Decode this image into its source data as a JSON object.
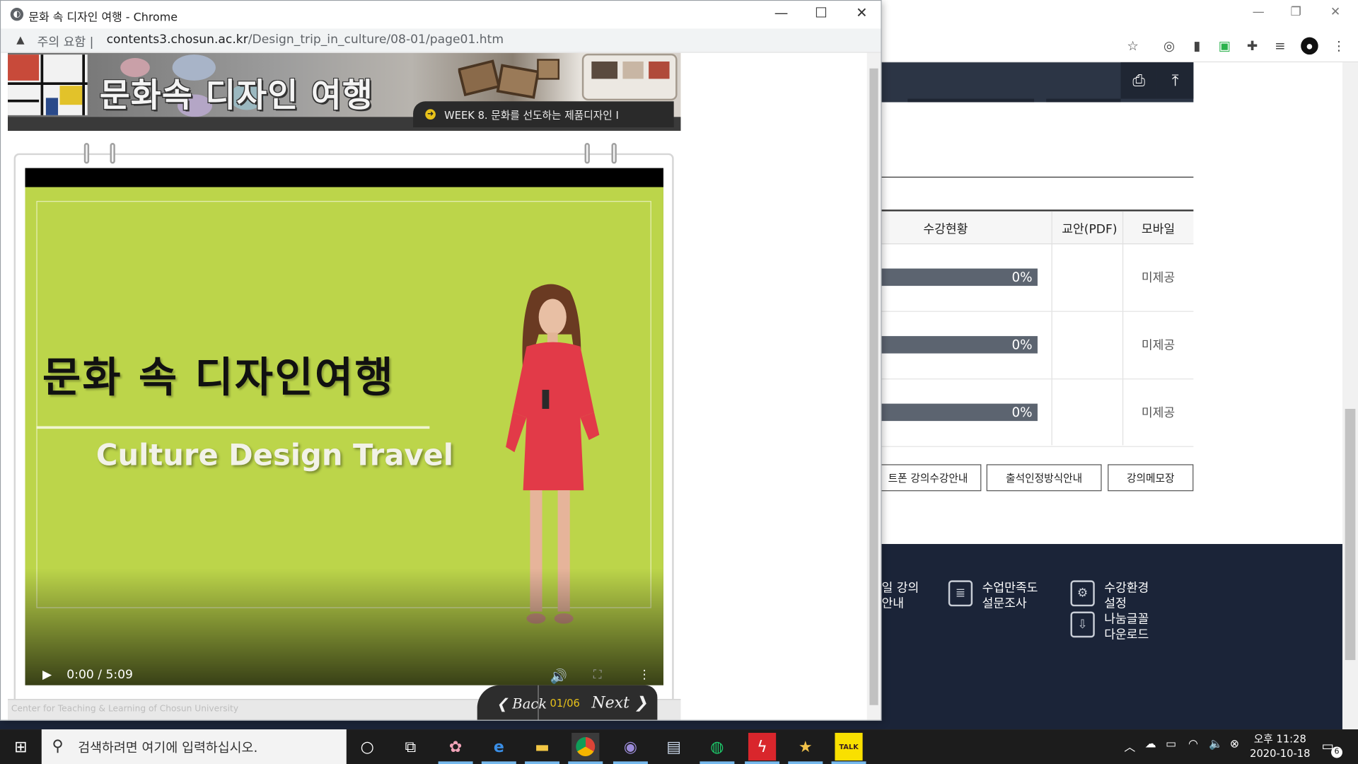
{
  "popup": {
    "window_title": "문화 속 디자인 여행 - Chrome",
    "security_label": "주의 요함",
    "url_host": "contents3.chosun.ac.kr",
    "url_path": "/Design_trip_in_culture/08-01/page01.htm",
    "minimize_glyph": "—",
    "maximize_glyph": "☐",
    "close_glyph": "✕"
  },
  "lesson": {
    "banner_title": "문화속 디자인 여행",
    "week_label": "WEEK 8. 문화를 선도하는 제품디자인 I",
    "video": {
      "slide_title": "문화 속 디자인여행",
      "slide_subtitle": "Culture Design Travel",
      "time_display": "0:00 / 5:09",
      "progress": 0
    },
    "copyright": "Center for Teaching & Learning of Chosun University",
    "nav": {
      "back_label": "Back",
      "page_indicator": "01/06",
      "next_label": "Next"
    }
  },
  "background": {
    "table_headers": [
      "수강현황",
      "교안(PDF)",
      "모바일"
    ],
    "rows": [
      {
        "progress": "0%",
        "mobile": "미제공"
      },
      {
        "progress": "0%",
        "mobile": "미제공"
      },
      {
        "progress": "0%",
        "mobile": "미제공"
      }
    ],
    "buttons": [
      "트폰 강의수강안내",
      "출석인정방식안내",
      "강의메모장"
    ],
    "footer": {
      "item1_line1": "일 강의",
      "item1_line2": "안내",
      "survey_line1": "수업만족도",
      "survey_line2": "설문조사",
      "settings_line1": "수강환경",
      "settings_line2": "설정",
      "font_line1": "나눔글꼴",
      "font_line2": "다운로드"
    }
  },
  "taskbar": {
    "search_placeholder": "검색하려면 여기에 입력하십시오.",
    "clock_time": "오후 11:28",
    "clock_date": "2020-10-18",
    "notification_count": "6",
    "kakao_label": "TALK"
  },
  "colors": {
    "video_bg": "#bcd54a",
    "footer_bg": "#1b2438",
    "progress_bar": "#5c6470",
    "accent_yellow": "#e8c21a"
  }
}
